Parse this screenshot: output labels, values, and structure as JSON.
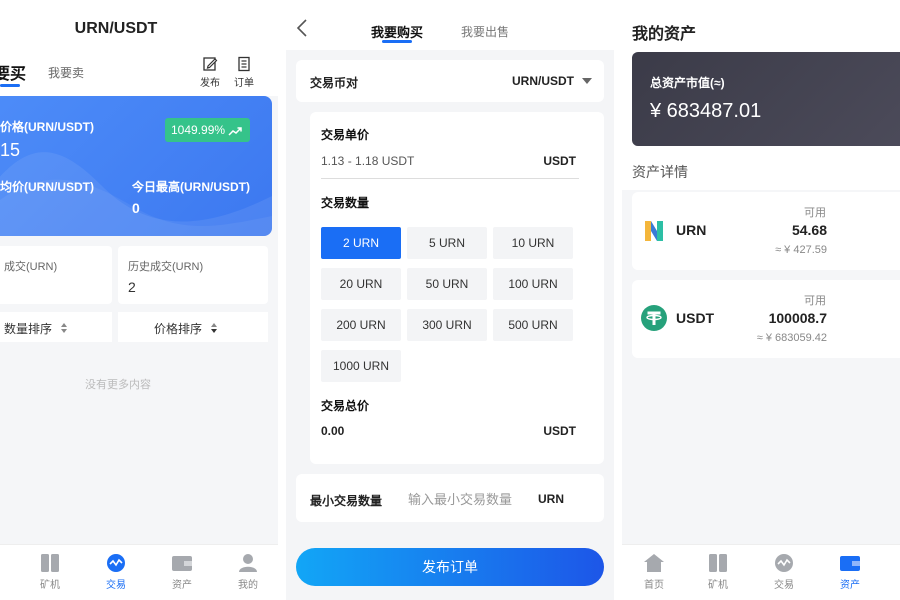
{
  "panel1": {
    "title": "URN/USDT",
    "tabs": {
      "buy": "要买",
      "sell": "我要卖"
    },
    "tools": {
      "publish": "发布",
      "orders": "订单"
    },
    "card": {
      "price_label": "价格(URN/USDT)",
      "price_value": "15",
      "change_badge": "1049.99%",
      "avg_label": "均价(URN/USDT)",
      "high_label": "今日最高(URN/USDT)",
      "high_value": "0"
    },
    "stats": {
      "volume_label": "成交(URN)",
      "history_label": "历史成交(URN)",
      "history_value": "2"
    },
    "sort": {
      "qty": "数量排序",
      "price": "价格排序"
    },
    "empty": "没有更多内容",
    "tabbar": [
      {
        "label": "矿机"
      },
      {
        "label": "交易"
      },
      {
        "label": "资产"
      },
      {
        "label": "我的"
      }
    ]
  },
  "panel2": {
    "tabs": {
      "buy": "我要购买",
      "sell": "我要出售"
    },
    "pair_label": "交易币对",
    "pair_value": "URN/USDT",
    "unit_price_label": "交易单价",
    "unit_price_range": "1.13 - 1.18 USDT",
    "unit_price_unit": "USDT",
    "qty_label": "交易数量",
    "qty_options": [
      "2 URN",
      "5 URN",
      "10 URN",
      "20 URN",
      "50 URN",
      "100 URN",
      "200 URN",
      "300 URN",
      "500 URN",
      "1000 URN"
    ],
    "qty_selected": "2 URN",
    "total_label": "交易总价",
    "total_value": "0.00",
    "total_unit": "USDT",
    "min_label": "最小交易数量",
    "min_placeholder": "输入最小交易数量",
    "min_unit": "URN",
    "submit": "发布订单"
  },
  "panel3": {
    "title": "我的资产",
    "total_label": "总资产市值(≈)",
    "total_value": "¥ 683487.01",
    "details_label": "资产详情",
    "assets": [
      {
        "name": "URN",
        "available_label": "可用",
        "amount": "54.68",
        "cny": "≈ ¥ 427.59"
      },
      {
        "name": "USDT",
        "available_label": "可用",
        "amount": "100008.7",
        "cny": "≈ ¥ 683059.42"
      }
    ],
    "tabbar": [
      {
        "label": "首页"
      },
      {
        "label": "矿机"
      },
      {
        "label": "交易"
      },
      {
        "label": "资产"
      }
    ]
  },
  "colors": {
    "accent": "#1a6ef5",
    "badge_green": "#35c38a",
    "usdt_green": "#26a17b",
    "dark_card": "#3b3b48"
  }
}
